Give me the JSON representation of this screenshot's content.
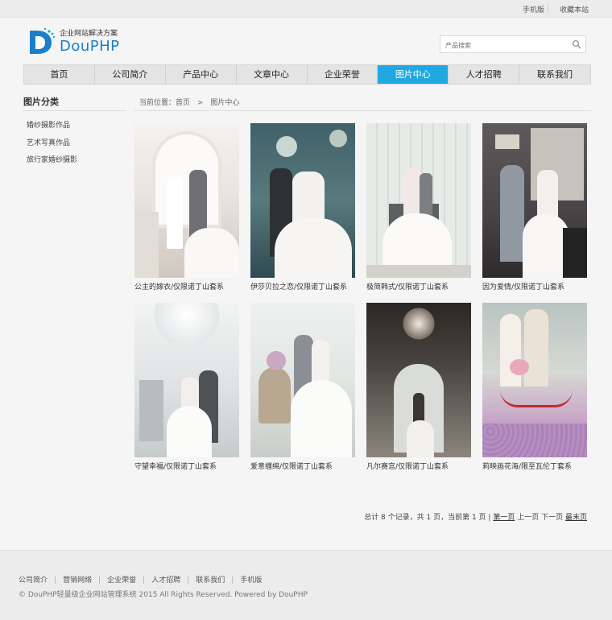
{
  "topbar": {
    "mobile": "手机版",
    "bookmark": "收藏本站"
  },
  "logo": {
    "tagline": "企业网站解决方案",
    "brand": "DouPHP"
  },
  "search": {
    "placeholder": "产品搜索"
  },
  "nav": [
    "首页",
    "公司简介",
    "产品中心",
    "文章中心",
    "企业荣誉",
    "图片中心",
    "人才招聘",
    "联系我们"
  ],
  "nav_active": 5,
  "sidebar": {
    "title": "图片分类",
    "items": [
      "婚纱摄影作品",
      "艺术写真作品",
      "旅行家婚纱摄影"
    ]
  },
  "breadcrumb": {
    "prefix": "当前位置：首页",
    "sep": ">",
    "current": "图片中心"
  },
  "gallery": [
    "公主的嫁衣/仅限诺丁山套系",
    "伊莎贝拉之恋/仅限诺丁山套系",
    "极简韩式/仅限诺丁山套系",
    "因为爱情/仅限诺丁山套系",
    "守望幸福/仅限诺丁山套系",
    "爱意缠绵/仅限诺丁山套系",
    "凡尔赛宫/仅限诺丁山套系",
    "莉映画花海/限至瓦伦丁套系"
  ],
  "pager": {
    "summary": "总计 8 个记录，共 1 页，当前第 1 页 |",
    "first": "第一页",
    "prev": "上一页",
    "next": "下一页",
    "last": "最末页"
  },
  "footer": {
    "links": [
      "公司简介",
      "营销网络",
      "企业荣誉",
      "人才招聘",
      "联系我们",
      "手机版"
    ],
    "copyright": "© DouPHP轻量级企业网站管理系统 2015 All Rights Reserved. Powered by DouPHP"
  },
  "colors": {
    "accent": "#1fa9e0",
    "brand": "#1a7fcb"
  }
}
